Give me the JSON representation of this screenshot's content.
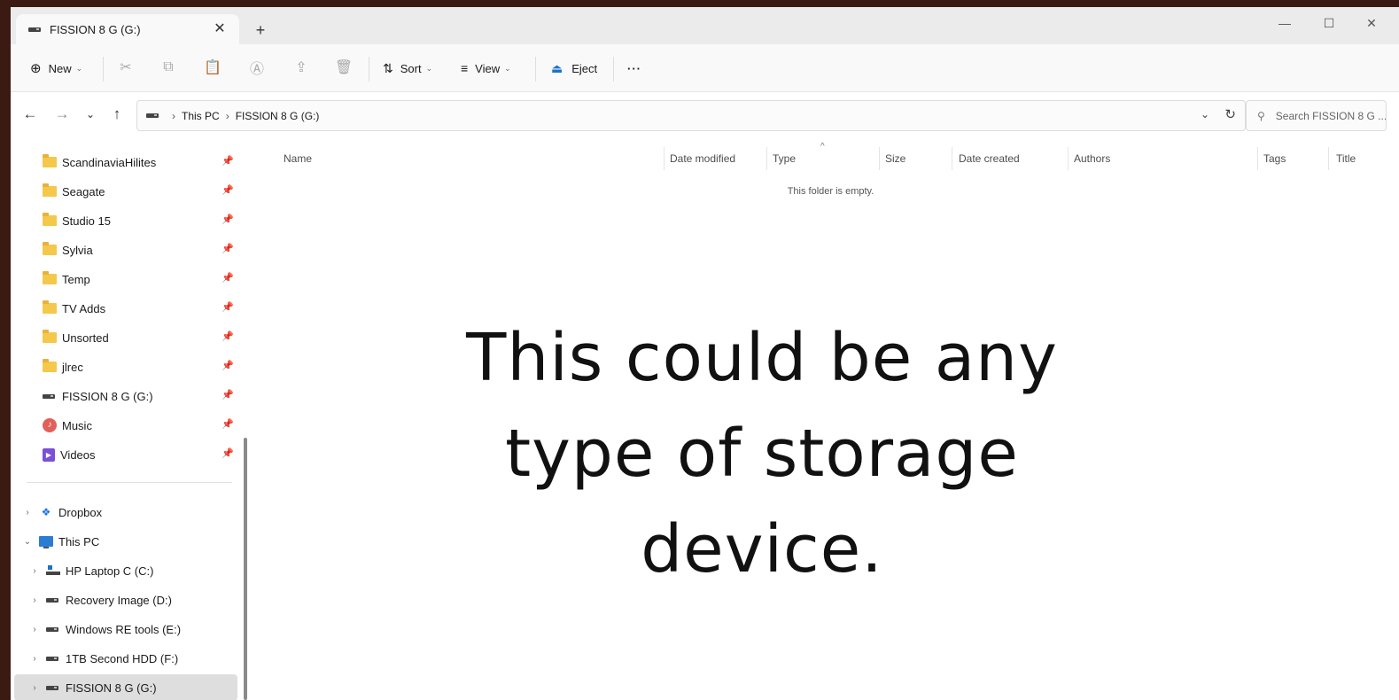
{
  "tab": {
    "title": "FISSION 8 G (G:)"
  },
  "window_controls": {
    "minimize": "—",
    "maximize": "☐",
    "close": "✕"
  },
  "commandbar": {
    "new_label": "New",
    "sort_label": "Sort",
    "view_label": "View",
    "eject_label": "Eject",
    "more_label": "···"
  },
  "address": {
    "crumbs": [
      "This PC",
      "FISSION 8 G (G:)"
    ],
    "search_placeholder": "Search FISSION 8 G ..."
  },
  "sidebar": {
    "pinned": [
      {
        "label": "ScandinaviaHilites",
        "icon": "folder-icon"
      },
      {
        "label": "Seagate",
        "icon": "folder-icon"
      },
      {
        "label": "Studio 15",
        "icon": "folder-icon"
      },
      {
        "label": "Sylvia",
        "icon": "folder-icon"
      },
      {
        "label": "Temp",
        "icon": "folder-icon"
      },
      {
        "label": "TV Adds",
        "icon": "folder-icon"
      },
      {
        "label": "Unsorted",
        "icon": "folder-icon"
      },
      {
        "label": "jlrec",
        "icon": "folder-icon"
      },
      {
        "label": "FISSION 8 G (G:)",
        "icon": "usb-drive-icon"
      },
      {
        "label": "Music",
        "icon": "music-icon"
      },
      {
        "label": "Videos",
        "icon": "videos-icon"
      }
    ],
    "tree": [
      {
        "label": "Dropbox",
        "icon": "dropbox-icon",
        "expander": "›"
      },
      {
        "label": "This PC",
        "icon": "this-pc-icon",
        "expander": "⌄"
      },
      {
        "label": "HP Laptop C (C:)",
        "icon": "laptop-drive-icon",
        "expander": "›"
      },
      {
        "label": "Recovery Image (D:)",
        "icon": "drive-icon",
        "expander": "›"
      },
      {
        "label": "Windows RE tools (E:)",
        "icon": "drive-icon",
        "expander": "›"
      },
      {
        "label": "1TB Second HDD (F:)",
        "icon": "drive-icon",
        "expander": "›"
      },
      {
        "label": "FISSION 8 G (G:)",
        "icon": "drive-icon",
        "expander": "›"
      }
    ]
  },
  "columns": [
    "Name",
    "Date modified",
    "Type",
    "Size",
    "Date created",
    "Authors",
    "Tags",
    "Title"
  ],
  "content": {
    "empty_message": "This folder is empty.",
    "caption": "This could be any type of storage device."
  }
}
